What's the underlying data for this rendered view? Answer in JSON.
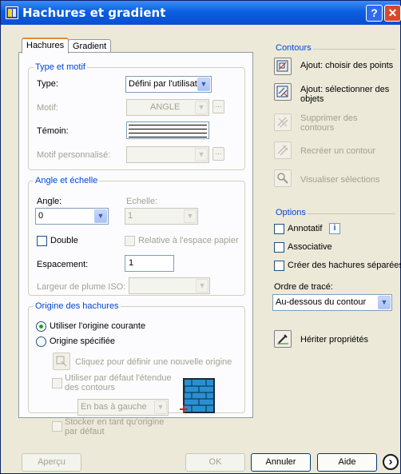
{
  "window": {
    "title": "Hachures et gradient",
    "help_btn": "?",
    "close_btn": "✕"
  },
  "tabs": {
    "hatch": "Hachures",
    "gradient": "Gradient"
  },
  "type_motif": {
    "legend": "Type et motif",
    "type_label": "Type:",
    "type_value": "Défini par l'utilisateur",
    "motif_label": "Motif:",
    "motif_value": "ANGLE",
    "temoin_label": "Témoin:",
    "custom_label": "Motif personnalisé:",
    "custom_value": "",
    "browse": "..."
  },
  "angle_echelle": {
    "legend": "Angle et échelle",
    "angle_label": "Angle:",
    "angle_value": "0",
    "scale_label": "Echelle:",
    "scale_value": "1",
    "double_label": "Double",
    "paper_label": "Relative à l'espace papier",
    "spacing_label": "Espacement:",
    "spacing_value": "1",
    "pen_label": "Largeur de plume ISO:",
    "pen_value": ""
  },
  "origine": {
    "legend": "Origine des hachures",
    "current_label": "Utiliser l'origine courante",
    "specified_label": "Origine spécifiée",
    "click_label": "Cliquez pour définir une nouvelle origine",
    "default_extent_label_1": "Utiliser par défaut l'étendue",
    "default_extent_label_2": "des contours",
    "position_value": "En bas à gauche",
    "store_label_1": "Stocker en tant qu'origine",
    "store_label_2": "par défaut"
  },
  "contours": {
    "legend": "Contours",
    "add_points": "Ajout: choisir des points",
    "add_objects_1": "Ajout: sélectionner des",
    "add_objects_2": "objets",
    "remove_1": "Supprimer des",
    "remove_2": "contours",
    "recreate": "Recréer un contour",
    "view": "Visualiser sélections"
  },
  "options": {
    "legend": "Options",
    "annotative": "Annotatif",
    "info": "i",
    "associative": "Associative",
    "separate": "Créer des hachures séparées",
    "draw_order_label": "Ordre de tracé:",
    "draw_order_value": "Au-dessous du contour"
  },
  "inherit": "Hériter propriétés",
  "footer": {
    "preview": "Aperçu",
    "ok": "OK",
    "cancel": "Annuler",
    "help": "Aide",
    "more": "›"
  },
  "colors": {
    "title_bar": "#0a5fe0",
    "group_legend": "#0046d5",
    "dialog_bg": "#ece9d8"
  }
}
